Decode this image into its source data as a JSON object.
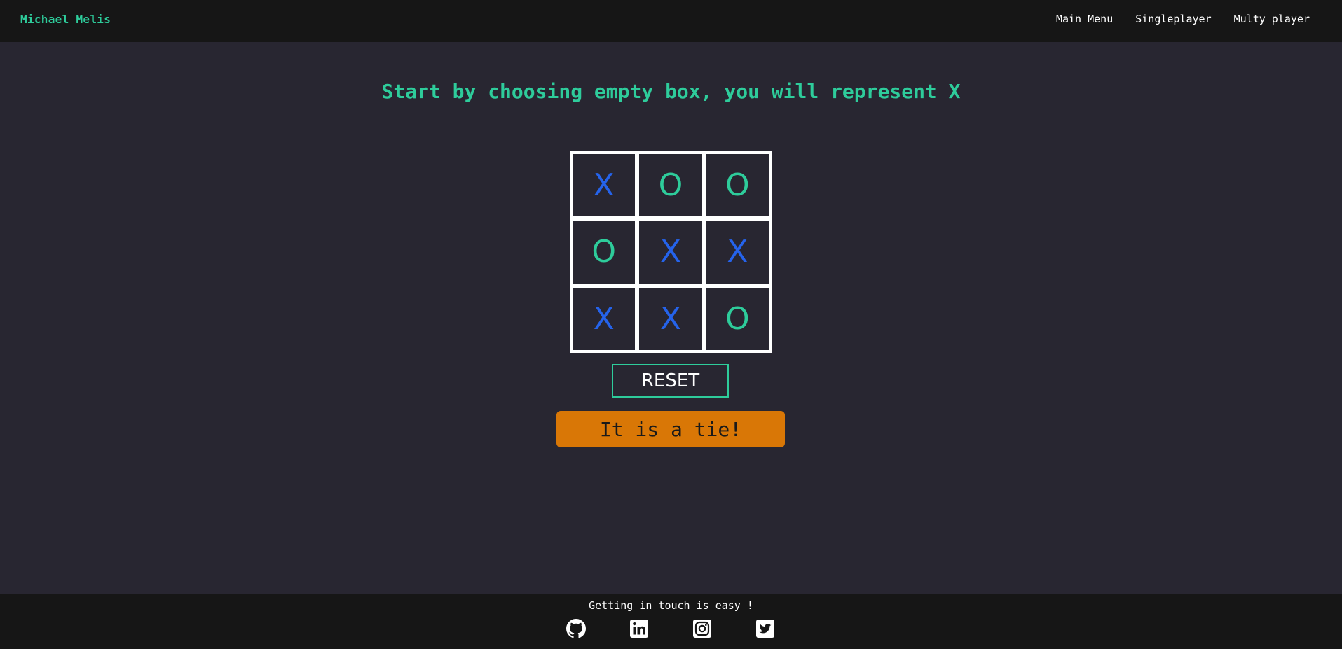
{
  "navbar": {
    "brand": "Michael Melis",
    "links": [
      "Main Menu",
      "Singleplayer",
      "Multy player"
    ]
  },
  "game": {
    "instruction": "Start by choosing empty box, you will represent X",
    "board": [
      "X",
      "O",
      "O",
      "O",
      "X",
      "X",
      "X",
      "X",
      "O"
    ],
    "reset_label": "RESET",
    "result": "It is a tie!"
  },
  "footer": {
    "text": "Getting in touch is easy !",
    "icons": [
      "github-icon",
      "linkedin-icon",
      "instagram-icon",
      "twitter-icon"
    ]
  },
  "colors": {
    "accent": "#2ecc9b",
    "x_color": "#2563eb",
    "result_bg": "#d97706",
    "background": "#282631",
    "bar": "#161616"
  }
}
